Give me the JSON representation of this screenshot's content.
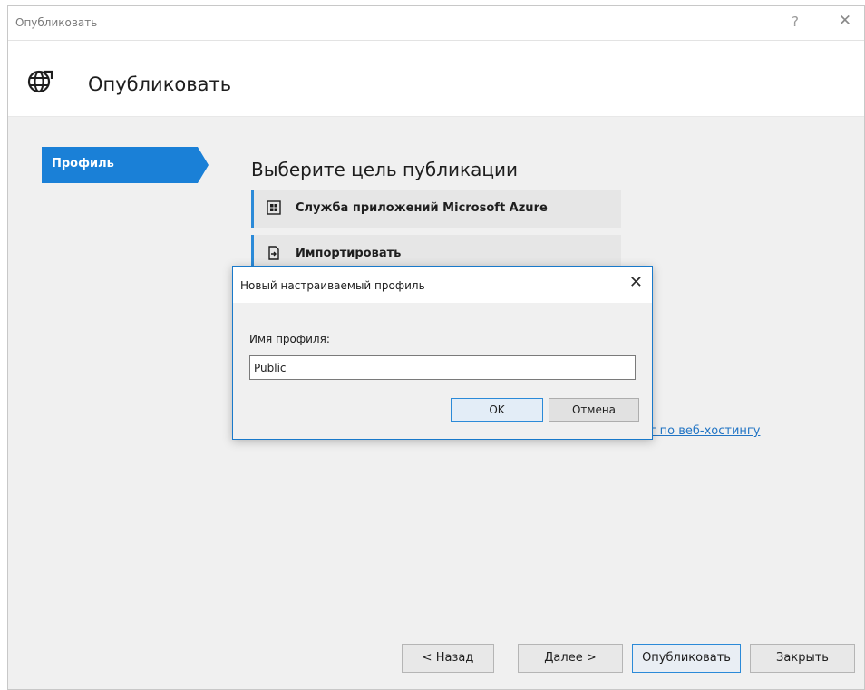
{
  "window": {
    "title": "Опубликовать",
    "help_label": "?",
    "close_label": "✕"
  },
  "header": {
    "title": "Опубликовать"
  },
  "nav": {
    "items": [
      {
        "label": "Профиль",
        "selected": true
      }
    ]
  },
  "main": {
    "title": "Выберите цель публикации",
    "targets": [
      {
        "label": "Служба приложений Microsoft Azure",
        "icon": "azure-app-service-icon"
      },
      {
        "label": "Импортировать",
        "icon": "import-file-icon"
      }
    ],
    "hosting_link": "уг по веб-хостингу"
  },
  "buttons": {
    "back": "< Назад",
    "next": "Далее >",
    "publish": "Опубликовать",
    "close": "Закрыть"
  },
  "dialog": {
    "title": "Новый настраиваемый профиль",
    "close_label": "✕",
    "field_label": "Имя профиля:",
    "field_value": "Public",
    "ok": "OK",
    "cancel": "Отмена"
  },
  "colors": {
    "accent": "#1a80d7",
    "link": "#2174c4",
    "dialog_border": "#1979ca"
  }
}
